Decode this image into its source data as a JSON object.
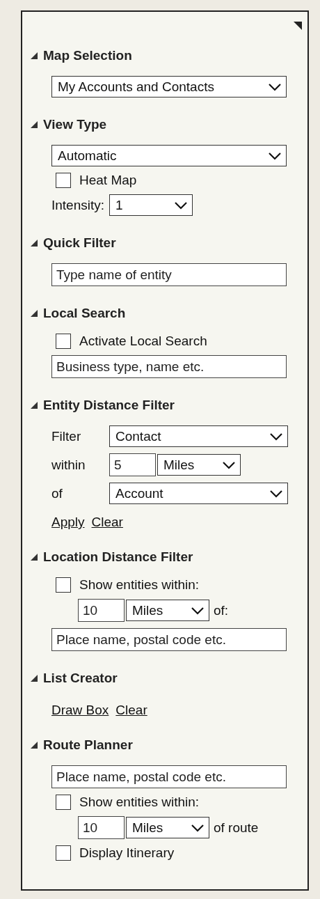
{
  "panel": {
    "sections": [
      {
        "title": "Map Selection",
        "expanded": true,
        "controls": [
          {
            "kind": "select",
            "value": "My Accounts and Contacts"
          }
        ]
      },
      {
        "title": "View Type",
        "expanded": true,
        "controls": [
          {
            "kind": "select",
            "value": "Automatic"
          },
          {
            "kind": "checkbox",
            "label": "Heat Map",
            "checked": false
          },
          {
            "kind": "row",
            "items": [
              {
                "kind": "label",
                "text": "Intensity:"
              },
              {
                "kind": "select",
                "value": "1"
              }
            ]
          }
        ]
      },
      {
        "title": "Quick Filter",
        "expanded": true,
        "controls": [
          {
            "kind": "input",
            "placeholder": "Type name of entity"
          }
        ]
      },
      {
        "title": "Local Search",
        "expanded": true,
        "controls": [
          {
            "kind": "checkbox",
            "label": "Activate Local Search",
            "checked": false
          },
          {
            "kind": "input",
            "placeholder": "Business type, name etc."
          }
        ]
      },
      {
        "title": "Entity Distance Filter",
        "expanded": true,
        "controls": [
          {
            "kind": "row",
            "items": [
              {
                "kind": "label",
                "text": "Filter"
              },
              {
                "kind": "select",
                "value": "Contact"
              }
            ]
          },
          {
            "kind": "row",
            "items": [
              {
                "kind": "label",
                "text": "within"
              },
              {
                "kind": "input",
                "value": "5"
              },
              {
                "kind": "select",
                "value": "Miles"
              }
            ]
          },
          {
            "kind": "row",
            "items": [
              {
                "kind": "label",
                "text": "of"
              },
              {
                "kind": "select",
                "value": "Account"
              }
            ]
          },
          {
            "kind": "links",
            "links": [
              "Apply",
              "Clear"
            ]
          }
        ]
      },
      {
        "title": "Location Distance Filter",
        "expanded": true,
        "controls": [
          {
            "kind": "checkbox",
            "label": "Show entities within:",
            "checked": false
          },
          {
            "kind": "row",
            "items": [
              {
                "kind": "input",
                "value": "10"
              },
              {
                "kind": "select",
                "value": "Miles"
              },
              {
                "kind": "label",
                "text": "of:"
              }
            ]
          },
          {
            "kind": "input",
            "placeholder": "Place name, postal code etc."
          }
        ]
      },
      {
        "title": "List Creator",
        "expanded": true,
        "controls": [
          {
            "kind": "links",
            "links": [
              "Draw Box",
              "Clear"
            ]
          }
        ]
      },
      {
        "title": "Route Planner",
        "expanded": true,
        "controls": [
          {
            "kind": "input",
            "placeholder": "Place name, postal code etc."
          },
          {
            "kind": "checkbox",
            "label": "Show entities within:",
            "checked": false
          },
          {
            "kind": "row",
            "items": [
              {
                "kind": "input",
                "value": "10"
              },
              {
                "kind": "select",
                "value": "Miles"
              },
              {
                "kind": "label",
                "text": "of route"
              }
            ]
          },
          {
            "kind": "checkbox",
            "label": "Display Itinerary",
            "checked": false
          }
        ]
      }
    ]
  }
}
